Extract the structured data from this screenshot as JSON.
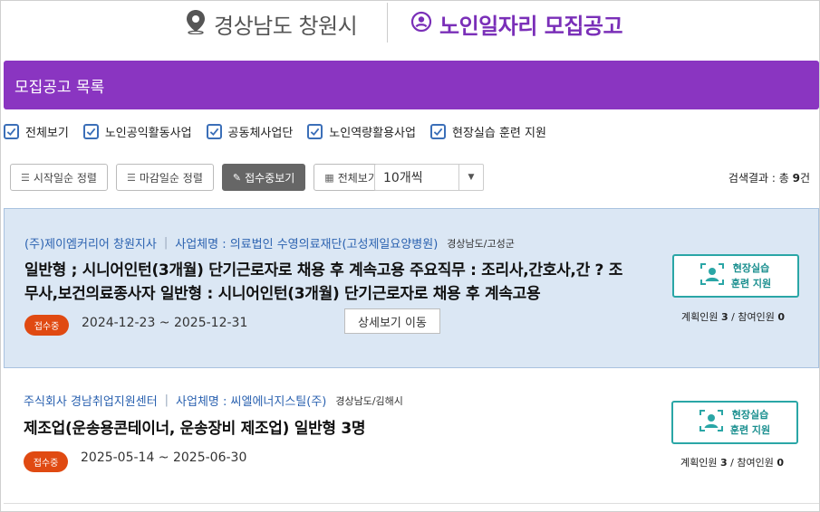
{
  "header": {
    "location_icon": "map-pin-icon",
    "location": "경상남도 창원시",
    "title_icon": "user-circle-icon",
    "title": "노인일자리 모집공고"
  },
  "list_bar": {
    "title": "모집공고 목록"
  },
  "filters": [
    {
      "label": "전체보기",
      "checked": true
    },
    {
      "label": "노인공익활동사업",
      "checked": true
    },
    {
      "label": "공동체사업단",
      "checked": true
    },
    {
      "label": "노인역량활용사업",
      "checked": true
    },
    {
      "label": "현장실습 훈련 지원",
      "checked": true
    }
  ],
  "toolbar": {
    "sort_start": "시작일순 정렬",
    "sort_end": "마감일순 정렬",
    "accepting": "접수중보기",
    "view_all": "전체보기",
    "page_size": "10개씩",
    "result_prefix": "검색결과 : 총 ",
    "result_count": "9",
    "result_suffix": "건"
  },
  "colors": {
    "brand_purple": "#8a35c1",
    "title_purple": "#7a2fb8",
    "badge_orange": "#e04a12",
    "teal": "#2aa6a6",
    "card_highlight": "#dbe7f4"
  },
  "postings": [
    {
      "org": "(주)제이엠커리어 창원지사",
      "sep": "|",
      "business": "사업체명 : 의료법인 수영의료재단(고성제일요양병원)",
      "region": "경상남도/고성군",
      "title_line1": "일반형 ; 시니어인턴(3개월) 단기근로자로 채용 후 계속고용 주요직무 : 조리사,간호사,간 ? 조",
      "title_line2": "무사,보건의료종사자 일반형 : 시니어인턴(3개월) 단기근로자로 채용 후 계속고용",
      "status": "접수중",
      "period": "2024-12-23 ~ 2025-12-31",
      "tooltip": "상세보기 이동",
      "training_line1": "현장실습",
      "training_line2": "훈련 지원",
      "planned_label": "계획인원",
      "planned": "3",
      "slash": "/",
      "joined_label": "참여인원",
      "joined": "0"
    },
    {
      "org": "주식회사 경남취업지원센터",
      "sep": "|",
      "business": "사업체명 : 씨엘에너지스틸(주)",
      "region": "경상남도/김해시",
      "title_line1": "제조업(운송용콘테이너, 운송장비 제조업) 일반형 3명",
      "status": "접수중",
      "period": "2025-05-14 ~ 2025-06-30",
      "training_line1": "현장실습",
      "training_line2": "훈련 지원",
      "planned_label": "계획인원",
      "planned": "3",
      "slash": "/",
      "joined_label": "참여인원",
      "joined": "0"
    }
  ]
}
